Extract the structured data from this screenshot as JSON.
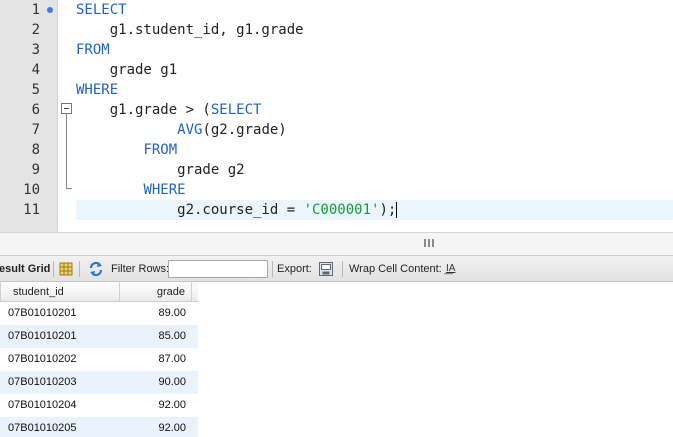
{
  "editor": {
    "line_numbers": [
      "1",
      "2",
      "3",
      "4",
      "5",
      "6",
      "7",
      "8",
      "9",
      "10",
      "11"
    ],
    "lines": [
      [
        {
          "t": "SELECT",
          "c": "kw"
        }
      ],
      [
        {
          "t": "    g1.student_id, g1.grade",
          "c": ""
        }
      ],
      [
        {
          "t": "FROM",
          "c": "kw"
        }
      ],
      [
        {
          "t": "    grade g1",
          "c": ""
        }
      ],
      [
        {
          "t": "WHERE",
          "c": "kw"
        }
      ],
      [
        {
          "t": "    g1.grade > (",
          "c": ""
        },
        {
          "t": "SELECT",
          "c": "kw"
        }
      ],
      [
        {
          "t": "            ",
          "c": ""
        },
        {
          "t": "AVG",
          "c": "fn"
        },
        {
          "t": "(g2.grade)",
          "c": ""
        }
      ],
      [
        {
          "t": "        ",
          "c": ""
        },
        {
          "t": "FROM",
          "c": "kw"
        }
      ],
      [
        {
          "t": "            grade g2",
          "c": ""
        }
      ],
      [
        {
          "t": "        ",
          "c": ""
        },
        {
          "t": "WHERE",
          "c": "kw"
        }
      ],
      [
        {
          "t": "            g2.course_id = ",
          "c": ""
        },
        {
          "t": "'C000001'",
          "c": "str"
        },
        {
          "t": ");",
          "c": ""
        }
      ]
    ],
    "current_line": 11,
    "colors": {
      "keyword": "#1f62c9",
      "string": "#139a39",
      "current_line": "#eaf6fb"
    }
  },
  "toolbar": {
    "result_grid_label": "esult Grid",
    "filter_rows_label": "Filter Rows:",
    "filter_value": "",
    "export_label": "Export:",
    "wrap_label": "Wrap Cell Content:",
    "wrap_icon_glyph": "I͟A",
    "icons": [
      "grid-view-icon",
      "refresh-icon",
      "export-icon",
      "wrap-cell-icon"
    ]
  },
  "grid": {
    "columns": [
      "student_id",
      "grade"
    ],
    "rows": [
      [
        "07B01010201",
        "89.00"
      ],
      [
        "07B01010201",
        "85.00"
      ],
      [
        "07B01010202",
        "87.00"
      ],
      [
        "07B01010203",
        "90.00"
      ],
      [
        "07B01010204",
        "92.00"
      ],
      [
        "07B01010205",
        "92.00"
      ]
    ],
    "alt_row_color": "#eaf2fb"
  }
}
